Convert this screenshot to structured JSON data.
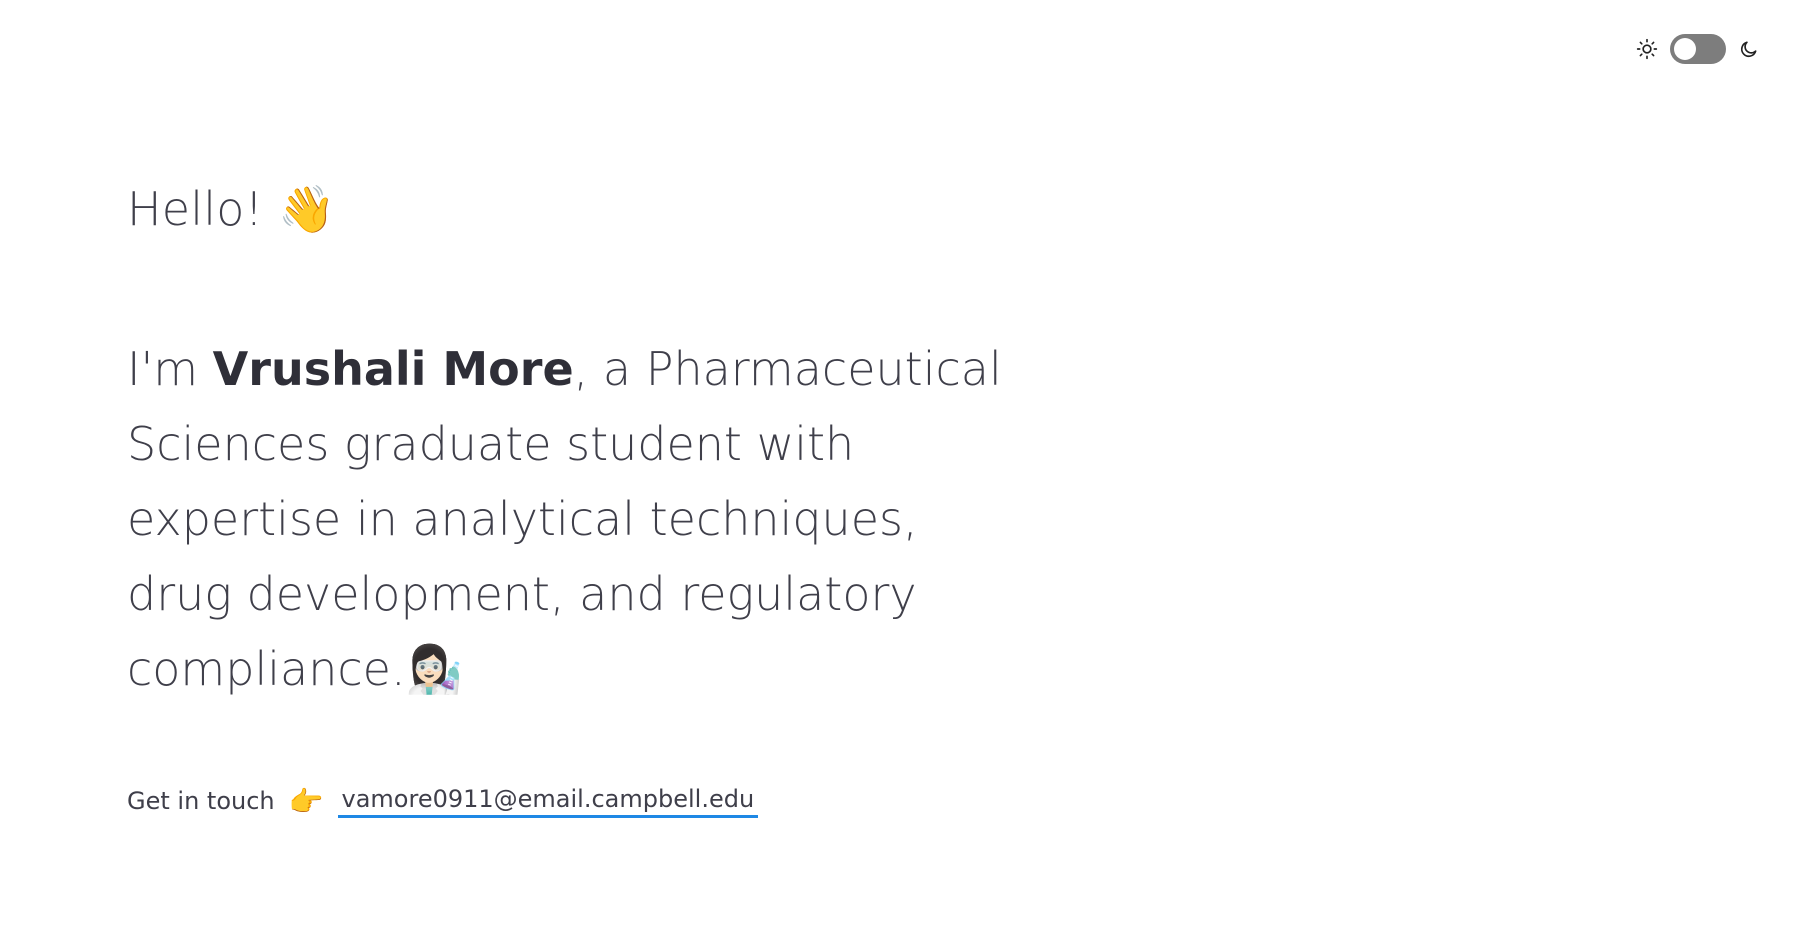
{
  "theme_toggle": {
    "light_icon": "sun-icon",
    "dark_icon": "moon-icon",
    "state": "light"
  },
  "hero": {
    "greeting": "Hello!",
    "greeting_emoji": "👋",
    "intro_prefix": "I'm ",
    "name": "Vrushali More",
    "intro_suffix": ", a Pharmaceutical Sciences graduate student with expertise in analytical techniques, drug development, and regulatory compliance.",
    "intro_emoji": "👩🏻‍🔬"
  },
  "contact": {
    "label": "Get in touch",
    "pointer_emoji": "👉",
    "email": "vamore0911@email.campbell.edu"
  },
  "colors": {
    "link_underline": "#1e88e5",
    "text": "#3f3f4a",
    "toggle_track": "#7d7d7d"
  }
}
